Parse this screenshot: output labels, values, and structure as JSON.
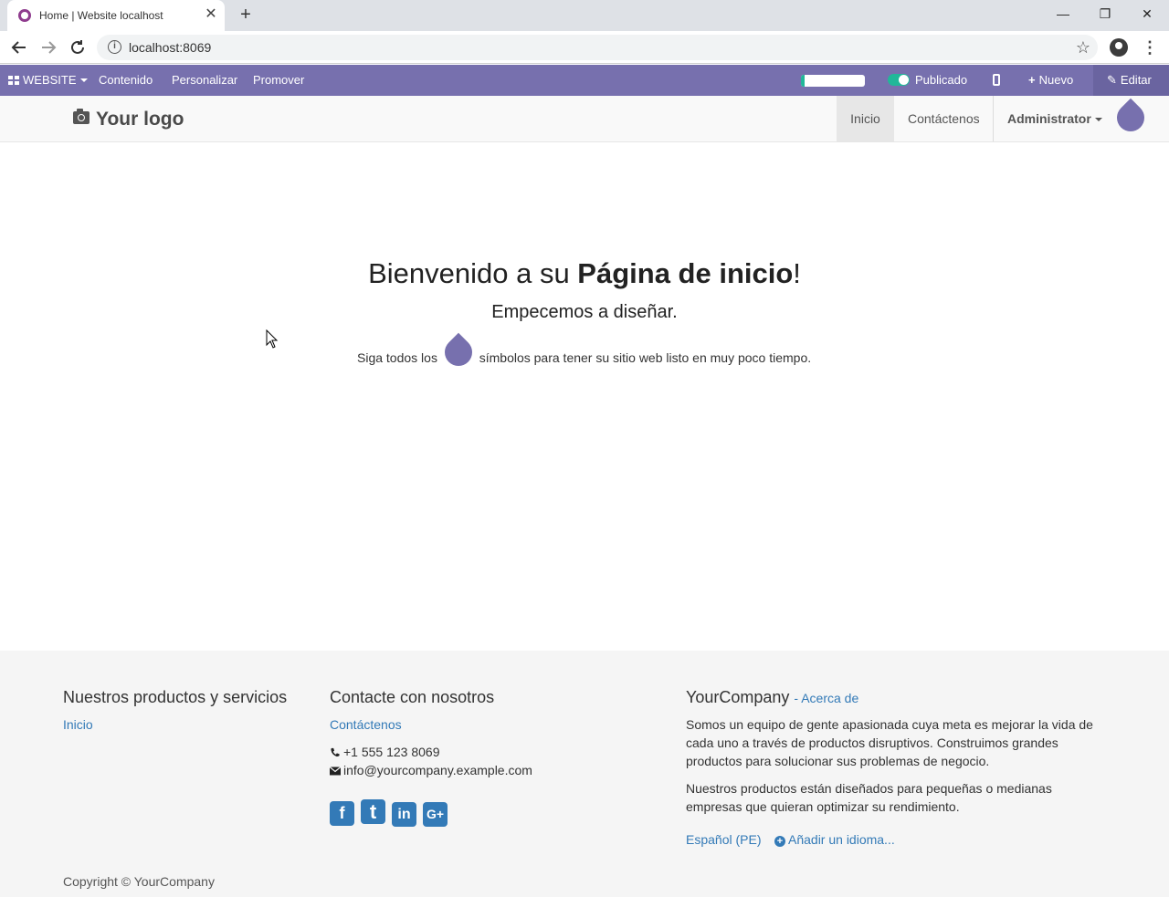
{
  "browser": {
    "tab_title": "Home | Website localhost",
    "url": "localhost:8069"
  },
  "adminbar": {
    "website_label": "WEBSITE",
    "contenido": "Contenido",
    "personalizar": "Personalizar",
    "promover": "Promover",
    "seo_progress": 0.05,
    "publicado": "Publicado",
    "nuevo": "Nuevo",
    "editar": "Editar",
    "accent": "#7770ae",
    "toggle_color": "#21b799"
  },
  "header": {
    "logo_text": "Your logo",
    "nav": {
      "inicio": "Inicio",
      "contactenos": "Contáctenos",
      "user": "Administrator"
    }
  },
  "hero": {
    "title_prefix": "Bienvenido a su ",
    "title_bold": "Página de inicio",
    "title_suffix": "!",
    "subtitle": "Empecemos a diseñar.",
    "hint_before": "Siga todos los",
    "hint_after": "símbolos para tener su sitio web listo en muy poco tiempo."
  },
  "footer": {
    "col1_title": "Nuestros productos y servicios",
    "col1_link": "Inicio",
    "col2_title": "Contacte con nosotros",
    "col2_link": "Contáctenos",
    "phone": "+1 555 123 8069",
    "email": "info@yourcompany.example.com",
    "social": [
      "f",
      "t",
      "in",
      "G+"
    ],
    "col3_title": "YourCompany",
    "col3_about": "- Acerca de",
    "about_p1": "Somos un equipo de gente apasionada cuya meta es mejorar la vida de cada uno a través de productos disruptivos. Construimos grandes productos para solucionar sus problemas de negocio.",
    "about_p2": "Nuestros productos están diseñados para pequeñas o medianas empresas que quieran optimizar su rendimiento.",
    "language": "Español (PE)",
    "add_language": "Añadir un idioma...",
    "copyright": "Copyright © YourCompany"
  }
}
